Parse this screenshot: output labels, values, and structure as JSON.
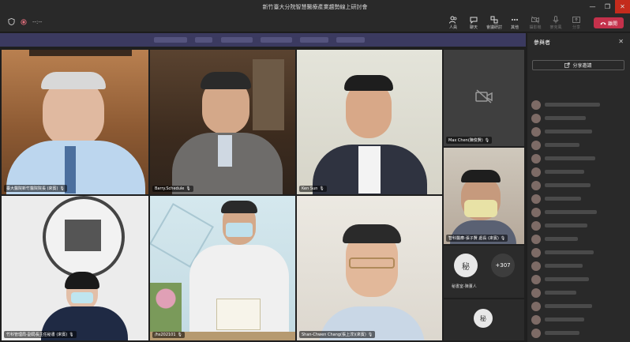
{
  "window": {
    "title": "新竹臺大分院智慧醫療產業趨勢線上研討會",
    "controls": [
      "—",
      "❐",
      "✕"
    ]
  },
  "toolbar": {
    "timer": "--:--",
    "items": [
      {
        "label": "人員",
        "icon": "people-icon",
        "active": true
      },
      {
        "label": "聊天",
        "icon": "chat-icon",
        "active": true
      },
      {
        "label": "會議研討",
        "icon": "breakout-icon",
        "active": true
      },
      {
        "label": "其他",
        "icon": "more-icon",
        "active": true
      },
      {
        "label": "攝影機",
        "icon": "camera-icon",
        "active": false
      },
      {
        "label": "麥克風",
        "icon": "mic-icon",
        "active": false
      },
      {
        "label": "分享",
        "icon": "share-icon",
        "active": false
      }
    ],
    "leave": "離開"
  },
  "participants": {
    "title": "參與者",
    "share_invite": "分享邀請"
  },
  "tiles": [
    {
      "name": "臺大醫院新竹醫院院長 (來賓)",
      "bg": "#a9754a"
    },
    {
      "name": "Barry.Schedule",
      "bg": "#4a3a2a"
    },
    {
      "name": "Ken Sun",
      "bg": "#dcdcd2"
    },
    {
      "name": "竹科管理局-副局長主任秘書 (來賓)",
      "bg": "#e6e6e6"
    },
    {
      "name": "/hs202101",
      "bg": "#cfe3ea"
    },
    {
      "name": "Shan-Chwen Chang(張上淳)(來賓)",
      "bg": "#e3e0da"
    }
  ],
  "side_tiles": [
    {
      "name": "Max Chen(陳俊賢)",
      "bg": "#3f3f3f"
    },
    {
      "name": "智科醫療-張子賢 處長 (來賓)",
      "bg": "#c0b8ac"
    }
  ],
  "overflow": {
    "avatar": "秘",
    "avatar_label": "秘書室-陳董人",
    "more": "+307",
    "avatar2": "秘"
  }
}
